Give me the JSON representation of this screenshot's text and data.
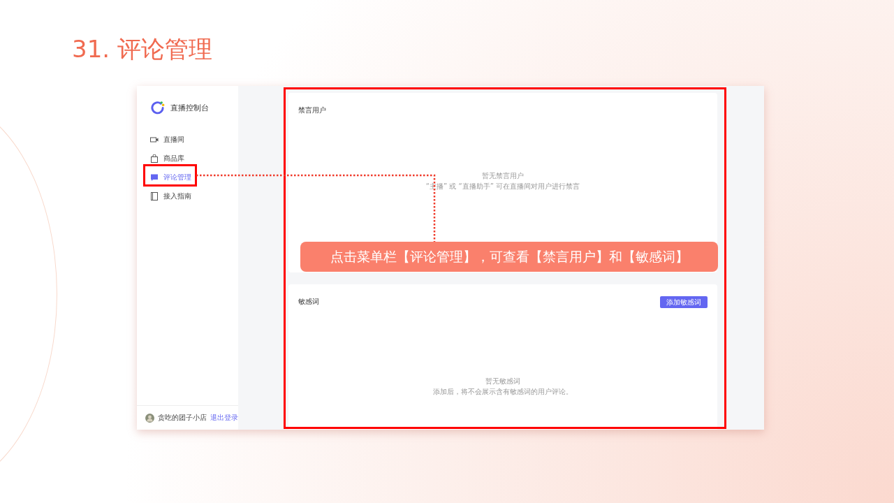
{
  "slide": {
    "title": "31. 评论管理"
  },
  "sidebar": {
    "brand": "直播控制台",
    "items": [
      {
        "label": "直播间",
        "selected": false
      },
      {
        "label": "商品库",
        "selected": false
      },
      {
        "label": "评论管理",
        "selected": true
      },
      {
        "label": "接入指南",
        "selected": false
      }
    ],
    "user": {
      "name": "贪吃的团子小店",
      "logout": "退出登录"
    }
  },
  "cards": [
    {
      "title": "禁言用户",
      "empty_title": "暂无禁言用户",
      "empty_hint": "“主播” 或 “直播助手” 可在直播间对用户进行禁言"
    },
    {
      "title": "敏感词",
      "button": "添加敏感词",
      "empty_title": "暂无敏感词",
      "empty_hint": "添加后，将不会展示含有敏感词的用户评论。"
    }
  ],
  "callout": "点击菜单栏【评论管理】，可查看【禁言用户】和【敏感词】"
}
